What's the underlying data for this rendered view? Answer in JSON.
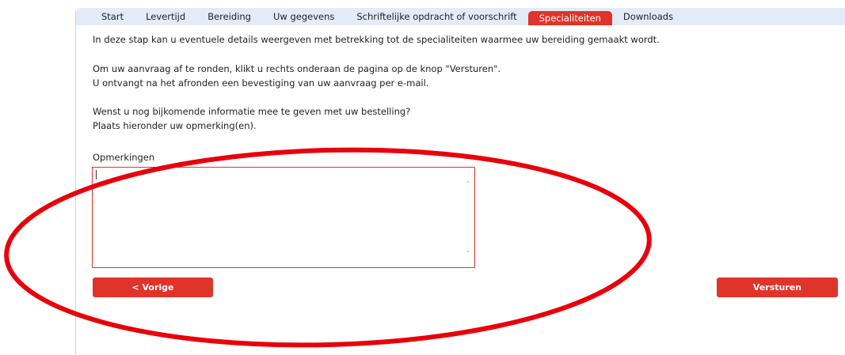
{
  "tabs": [
    {
      "label": "Start"
    },
    {
      "label": "Levertijd"
    },
    {
      "label": "Bereiding"
    },
    {
      "label": "Uw gegevens"
    },
    {
      "label": "Schriftelijke opdracht of voorschrift"
    },
    {
      "label": "Specialiteiten",
      "active": true
    },
    {
      "label": "Downloads"
    }
  ],
  "content": {
    "intro": "In deze stap kan u eventuele details weergeven met betrekking tot de specialiteiten waarmee uw bereiding gemaakt wordt.",
    "finish_line1": "Om uw aanvraag af te ronden, klikt u rechts onderaan de pagina op de knop \"Versturen\".",
    "finish_line2": "U ontvangt na het afronden een bevestiging van uw aanvraag per e-mail.",
    "question_line1": "Wenst u nog bijkomende informatie mee te geven met uw bestelling?",
    "question_line2": "Plaats hieronder uw opmerking(en).",
    "remarks_label": "Opmerkingen",
    "remarks_value": ""
  },
  "buttons": {
    "prev": "< Vorige",
    "send": "Versturen"
  },
  "colors": {
    "accent": "#e0332a",
    "tabbar": "#e4ebf8",
    "annotation": "#e8000b"
  }
}
